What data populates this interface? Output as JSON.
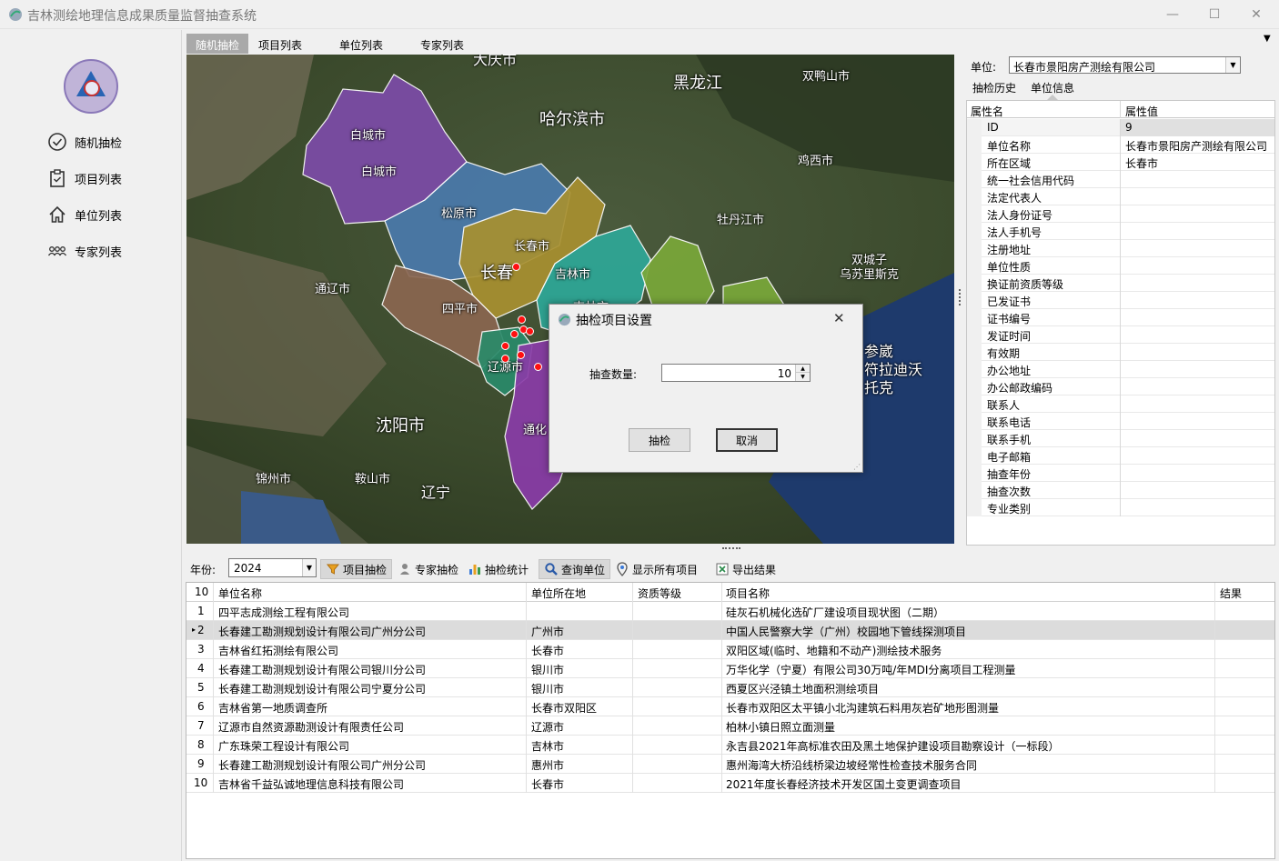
{
  "app": {
    "title": "吉林测绘地理信息成果质量监督抽查系统"
  },
  "window_controls": {
    "minimize": "—",
    "maximize": "☐",
    "close": "✕"
  },
  "nav": [
    {
      "label": "随机抽检",
      "icon": "check-circle-icon"
    },
    {
      "label": "项目列表",
      "icon": "clipboard-icon"
    },
    {
      "label": "单位列表",
      "icon": "home-icon"
    },
    {
      "label": "专家列表",
      "icon": "users-icon"
    }
  ],
  "tabs": [
    "随机抽检",
    "项目列表",
    "单位列表",
    "专家列表"
  ],
  "tab_overflow": "▼",
  "map": {
    "labels": [
      "大庆市",
      "黑龙江",
      "双鸭山市",
      "哈尔滨市",
      "鸡西市",
      "牡丹江市",
      "双城子\n乌苏里斯克",
      "通辽市",
      "参崴\n符拉迪沃\n托克",
      "沈阳市",
      "锦州市",
      "鞍山市",
      "辽宁"
    ],
    "regions": [
      "白城市",
      "白城市",
      "松原市",
      "长春市",
      "长春",
      "吉林市",
      "四平市",
      "辽源市",
      "通化",
      "吉林市"
    ]
  },
  "right_panel": {
    "unit_label": "单位:",
    "unit_value": "长春市景阳房产测绘有限公司",
    "subtabs": [
      "抽检历史",
      "单位信息"
    ],
    "grid_headers": [
      "属性名",
      "属性值"
    ],
    "properties": [
      {
        "name": "ID",
        "value": "9"
      },
      {
        "name": "单位名称",
        "value": "长春市景阳房产测绘有限公司"
      },
      {
        "name": "所在区域",
        "value": "长春市"
      },
      {
        "name": "统一社会信用代码",
        "value": ""
      },
      {
        "name": "法定代表人",
        "value": ""
      },
      {
        "name": "法人身份证号",
        "value": ""
      },
      {
        "name": "法人手机号",
        "value": ""
      },
      {
        "name": "注册地址",
        "value": ""
      },
      {
        "name": "单位性质",
        "value": ""
      },
      {
        "name": "换证前资质等级",
        "value": ""
      },
      {
        "name": "已发证书",
        "value": ""
      },
      {
        "name": "证书编号",
        "value": ""
      },
      {
        "name": "发证时间",
        "value": ""
      },
      {
        "name": "有效期",
        "value": ""
      },
      {
        "name": "办公地址",
        "value": ""
      },
      {
        "name": "办公邮政编码",
        "value": ""
      },
      {
        "name": "联系人",
        "value": ""
      },
      {
        "name": "联系电话",
        "value": ""
      },
      {
        "name": "联系手机",
        "value": ""
      },
      {
        "name": "电子邮箱",
        "value": ""
      },
      {
        "name": "抽查年份",
        "value": ""
      },
      {
        "name": "抽查次数",
        "value": ""
      },
      {
        "name": "专业类别",
        "value": ""
      }
    ]
  },
  "toolbar": {
    "year_label": "年份:",
    "year_value": "2024",
    "buttons": [
      "项目抽检",
      "专家抽检",
      "抽检统计",
      "查询单位",
      "显示所有项目",
      "导出结果"
    ]
  },
  "grid": {
    "count": "10",
    "headers": [
      "单位名称",
      "单位所在地",
      "资质等级",
      "项目名称",
      "结果"
    ],
    "rows": [
      {
        "n": "1",
        "unit": "四平志成测绘工程有限公司",
        "loc": "",
        "grade": "",
        "project": "硅灰石机械化选矿厂建设项目现状图（二期）",
        "result": ""
      },
      {
        "n": "2",
        "unit": "长春建工勘测规划设计有限公司广州分公司",
        "loc": "广州市",
        "grade": "",
        "project": "中国人民警察大学（广州）校园地下管线探测项目",
        "result": ""
      },
      {
        "n": "3",
        "unit": "吉林省红拓测绘有限公司",
        "loc": "长春市",
        "grade": "",
        "project": "双阳区域(临时、地籍和不动产)测绘技术服务",
        "result": ""
      },
      {
        "n": "4",
        "unit": "长春建工勘测规划设计有限公司银川分公司",
        "loc": "银川市",
        "grade": "",
        "project": "万华化学（宁夏）有限公司30万吨/年MDI分离项目工程测量",
        "result": ""
      },
      {
        "n": "5",
        "unit": "长春建工勘测规划设计有限公司宁夏分公司",
        "loc": "银川市",
        "grade": "",
        "project": "西夏区兴泾镇土地面积测绘项目",
        "result": ""
      },
      {
        "n": "6",
        "unit": "吉林省第一地质调查所",
        "loc": "长春市双阳区",
        "grade": "",
        "project": "长春市双阳区太平镇小北沟建筑石料用灰岩矿地形图测量",
        "result": ""
      },
      {
        "n": "7",
        "unit": "辽源市自然资源勘测设计有限责任公司",
        "loc": "辽源市",
        "grade": "",
        "project": "柏林小镇日照立面测量",
        "result": ""
      },
      {
        "n": "8",
        "unit": "广东珠荣工程设计有限公司",
        "loc": "吉林市",
        "grade": "",
        "project": "永吉县2021年高标准农田及黑土地保护建设项目勘察设计（一标段）",
        "result": ""
      },
      {
        "n": "9",
        "unit": "长春建工勘测规划设计有限公司广州分公司",
        "loc": "惠州市",
        "grade": "",
        "project": "惠州海湾大桥沿线桥梁边坡经常性检查技术服务合同",
        "result": ""
      },
      {
        "n": "10",
        "unit": "吉林省千益弘诚地理信息科技有限公司",
        "loc": "长春市",
        "grade": "",
        "project": "2021年度长春经济技术开发区国土变更调查项目",
        "result": ""
      }
    ]
  },
  "dialog": {
    "title": "抽检项目设置",
    "qty_label": "抽查数量:",
    "qty_value": "10",
    "ok": "抽检",
    "cancel": "取消",
    "close": "✕"
  },
  "colors": {
    "tab_active": "#a9a9a9",
    "marker": "#ff1010"
  }
}
